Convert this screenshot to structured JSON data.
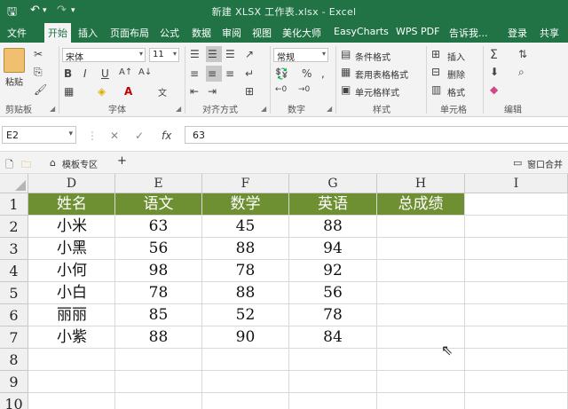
{
  "window": {
    "title": "新建 XLSX 工作表.xlsx  -  Excel"
  },
  "quick_access": {
    "save_icon": "save-icon",
    "undo_icon": "undo-icon",
    "redo_icon": "redo-icon",
    "customize_icon": "chevron-down-icon"
  },
  "ribbon_tabs": [
    "文件",
    "开始",
    "插入",
    "页面布局",
    "公式",
    "数据",
    "审阅",
    "视图",
    "美化大师",
    "EasyCharts",
    "WPS PDF",
    "告诉我...",
    "登录",
    "共享"
  ],
  "active_tab": "开始",
  "ribbon": {
    "paste_label": "粘贴",
    "font_name": "宋体",
    "font_size": "11",
    "bold": "B",
    "italic": "I",
    "underline": "U",
    "font_color_glyph": "A",
    "number_format": "常规",
    "percent": "%",
    "comma": ",",
    "conditional_format": "条件格式",
    "table_format": "套用表格格式",
    "cell_styles": "单元格样式",
    "insert": "插入",
    "delete": "删除",
    "format": "格式",
    "sum_glyph": "Σ",
    "groups": [
      "剪贴板",
      "字体",
      "对齐方式",
      "数字",
      "样式",
      "单元格",
      "编辑"
    ]
  },
  "formula_bar": {
    "name_box": "E2",
    "fx": "fx",
    "value": "63"
  },
  "sheet_strip": {
    "template_label": "模板专区",
    "add_label": "+",
    "right_label": "窗口合并"
  },
  "grid": {
    "columns": [
      "D",
      "E",
      "F",
      "G",
      "H",
      "I"
    ],
    "rows": [
      "1",
      "2",
      "3",
      "4",
      "5",
      "6",
      "7",
      "8",
      "9",
      "10"
    ],
    "header_row": [
      "姓名",
      "语文",
      "数学",
      "英语",
      "总成绩"
    ],
    "data": [
      [
        "小米",
        "63",
        "45",
        "88"
      ],
      [
        "小黑",
        "56",
        "88",
        "94"
      ],
      [
        "小何",
        "98",
        "78",
        "92"
      ],
      [
        "小白",
        "78",
        "88",
        "56"
      ],
      [
        "丽丽",
        "85",
        "52",
        "78"
      ],
      [
        "小紫",
        "88",
        "90",
        "84"
      ]
    ],
    "header_fill": "#6f8f33"
  }
}
